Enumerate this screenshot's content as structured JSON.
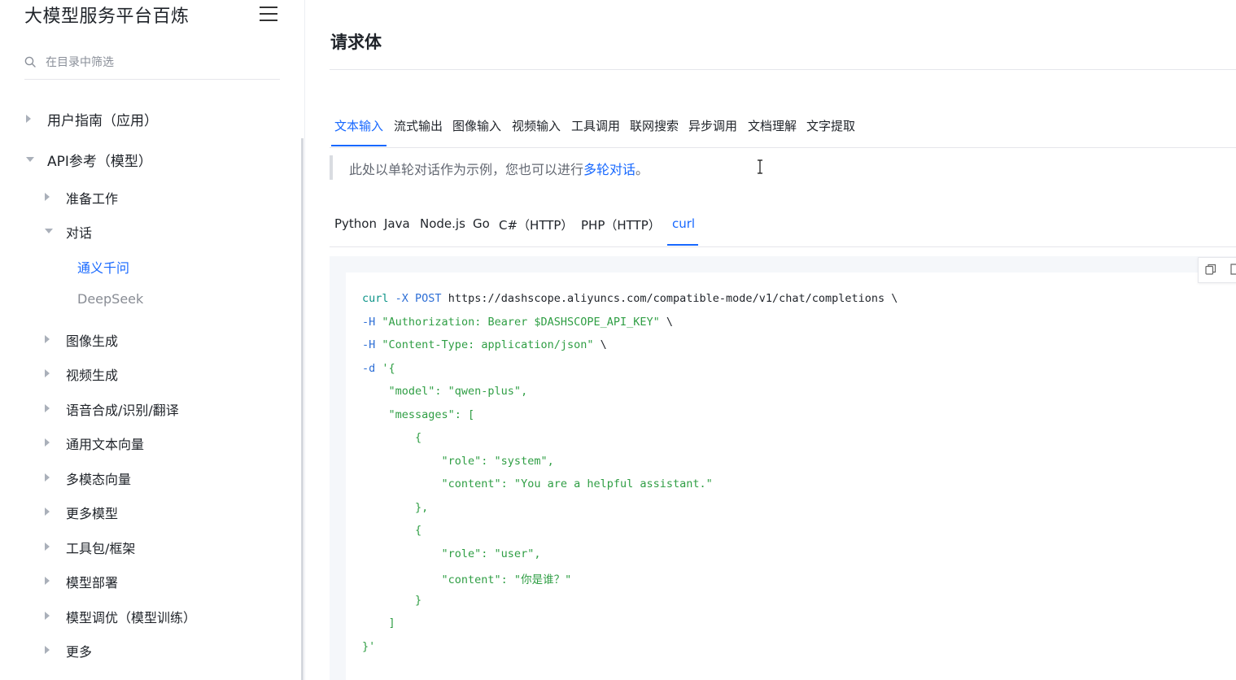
{
  "sidebar": {
    "brand": "大模型服务平台百炼",
    "search_placeholder": "在目录中筛选",
    "items": [
      {
        "label": "用户指南（应用）",
        "level": 1,
        "expanded": false
      },
      {
        "label": "API参考（模型）",
        "level": 1,
        "expanded": true
      },
      {
        "label": "准备工作",
        "level": 2,
        "expanded": false
      },
      {
        "label": "对话",
        "level": 2,
        "expanded": true
      },
      {
        "label": "通义千问",
        "level": 3,
        "active": true
      },
      {
        "label": "DeepSeek",
        "level": 3,
        "active": false
      },
      {
        "label": "图像生成",
        "level": 2,
        "expanded": false
      },
      {
        "label": "视频生成",
        "level": 2,
        "expanded": false
      },
      {
        "label": "语音合成/识别/翻译",
        "level": 2,
        "expanded": false
      },
      {
        "label": "通用文本向量",
        "level": 2,
        "expanded": false
      },
      {
        "label": "多模态向量",
        "level": 2,
        "expanded": false
      },
      {
        "label": "更多模型",
        "level": 2,
        "expanded": false
      },
      {
        "label": "工具包/框架",
        "level": 2,
        "expanded": false
      },
      {
        "label": "模型部署",
        "level": 2,
        "expanded": false
      },
      {
        "label": "模型调优（模型训练）",
        "level": 2,
        "expanded": false
      },
      {
        "label": "更多",
        "level": 2,
        "expanded": false
      }
    ]
  },
  "main": {
    "section_title": "请求体",
    "tabs": [
      {
        "label": "文本输入",
        "active": true
      },
      {
        "label": "流式输出",
        "active": false
      },
      {
        "label": "图像输入",
        "active": false
      },
      {
        "label": "视频输入",
        "active": false
      },
      {
        "label": "工具调用",
        "active": false
      },
      {
        "label": "联网搜索",
        "active": false
      },
      {
        "label": "异步调用",
        "active": false
      },
      {
        "label": "文档理解",
        "active": false
      },
      {
        "label": "文字提取",
        "active": false
      }
    ],
    "notice": {
      "text": "此处以单轮对话作为示例，您也可以进行",
      "link": "多轮对话",
      "suffix": "。"
    },
    "lang_tabs": [
      {
        "label": "Python",
        "active": false
      },
      {
        "label": "Java",
        "active": false
      },
      {
        "label": "Node.js",
        "active": false
      },
      {
        "label": "Go",
        "active": false
      },
      {
        "label": "C#（HTTP）",
        "active": false
      },
      {
        "label": "PHP（HTTP）",
        "active": false
      },
      {
        "label": "curl",
        "active": true
      }
    ],
    "code_lines": [
      [
        [
          "cmd",
          "curl"
        ],
        [
          "txt",
          " "
        ],
        [
          "flag",
          "-X POST"
        ],
        [
          "txt",
          " https://dashscope.aliyuncs.com/compatible-mode/v1/chat/completions \\"
        ]
      ],
      [
        [
          "flag",
          "-H"
        ],
        [
          "txt",
          " "
        ],
        [
          "str",
          "\"Authorization: Bearer $DASHSCOPE_API_KEY\""
        ],
        [
          "txt",
          " \\"
        ]
      ],
      [
        [
          "flag",
          "-H"
        ],
        [
          "txt",
          " "
        ],
        [
          "str",
          "\"Content-Type: application/json\""
        ],
        [
          "txt",
          " \\"
        ]
      ],
      [
        [
          "flag",
          "-d"
        ],
        [
          "txt",
          " "
        ],
        [
          "str",
          "'{"
        ]
      ],
      [
        [
          "str",
          "    \"model\": \"qwen-plus\","
        ]
      ],
      [
        [
          "str",
          "    \"messages\": ["
        ]
      ],
      [
        [
          "str",
          "        {"
        ]
      ],
      [
        [
          "str",
          "            \"role\": \"system\","
        ]
      ],
      [
        [
          "str",
          "            \"content\": \"You are a helpful assistant.\""
        ]
      ],
      [
        [
          "str",
          "        },"
        ]
      ],
      [
        [
          "str",
          "        {"
        ]
      ],
      [
        [
          "str",
          "            \"role\": \"user\","
        ]
      ],
      [
        [
          "str",
          "            \"content\": \"你是谁？\""
        ]
      ],
      [
        [
          "str",
          "        }"
        ]
      ],
      [
        [
          "str",
          "    ]"
        ]
      ],
      [
        [
          "str",
          "}'"
        ]
      ]
    ]
  },
  "icons": {
    "search": "search-icon",
    "menu": "hamburger-menu-icon",
    "copy": "copy-icon"
  },
  "colors": {
    "accent": "#1768ff",
    "code_string": "#2f9e44",
    "code_flag": "#2e6fd6"
  }
}
